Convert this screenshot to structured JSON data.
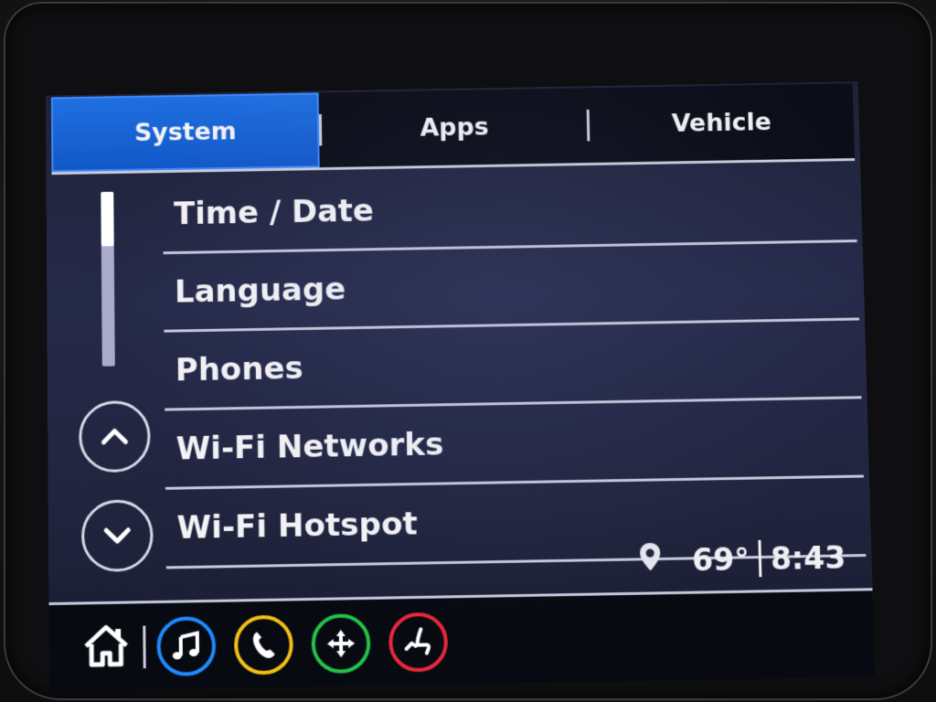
{
  "tabs": [
    {
      "label": "System",
      "active": true
    },
    {
      "label": "Apps",
      "active": false
    },
    {
      "label": "Vehicle",
      "active": false
    }
  ],
  "menu": {
    "items": [
      "Time / Date",
      "Language",
      "Phones",
      "Wi-Fi Networks",
      "Wi-Fi Hotspot"
    ]
  },
  "scroll": {
    "up_icon": "chevron-up-icon",
    "down_icon": "chevron-down-icon"
  },
  "status": {
    "location_icon": "location-pin-icon",
    "temperature": "69°",
    "time": "8:43"
  },
  "dock": {
    "home_icon": "home-icon",
    "buttons": [
      {
        "icon": "music-note-icon",
        "color": "#1e8bff"
      },
      {
        "icon": "phone-icon",
        "color": "#f2c114"
      },
      {
        "icon": "navigation-icon",
        "color": "#23c24a"
      },
      {
        "icon": "seat-icon",
        "color": "#e8283a"
      }
    ]
  },
  "colors": {
    "active_tab": "#1f6fe0",
    "screen_bg": "#262a4a"
  }
}
